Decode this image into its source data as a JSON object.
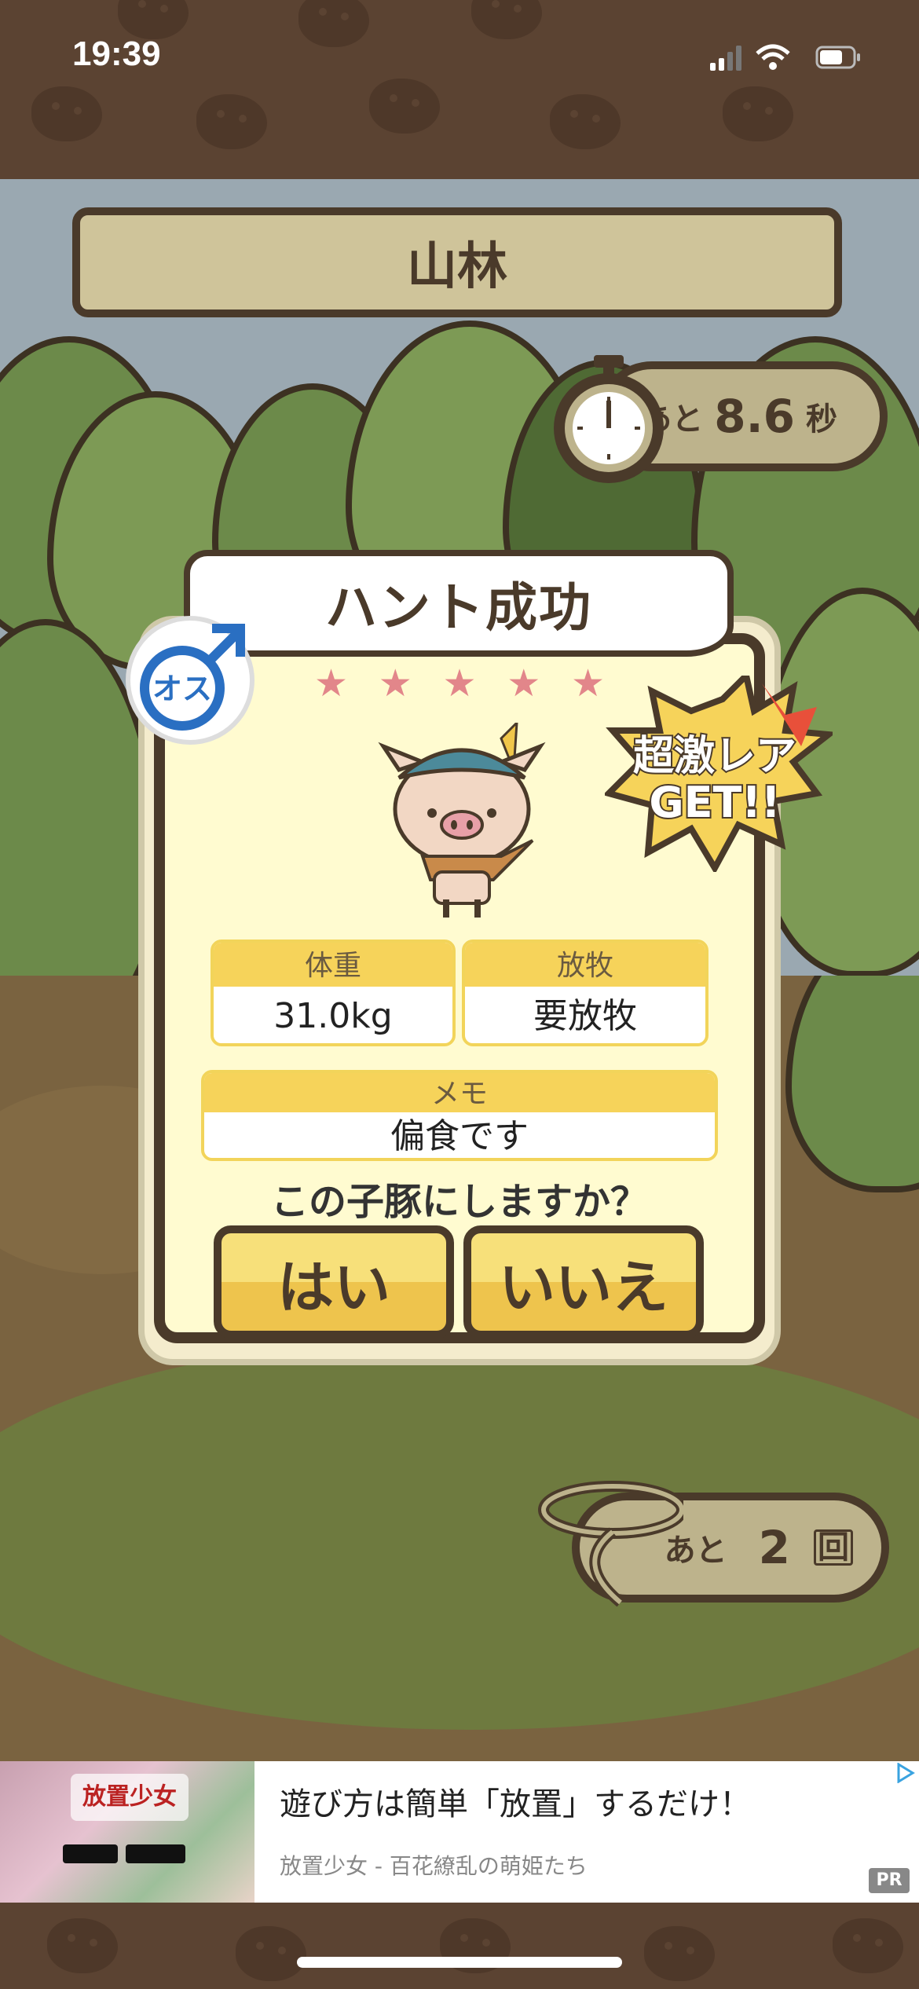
{
  "status_bar": {
    "time": "19:39"
  },
  "location": {
    "title": "山林"
  },
  "timer": {
    "prefix": "あと",
    "value": "8.6",
    "unit": "秒"
  },
  "dialog": {
    "banner": "ハント成功",
    "stars": 5,
    "gender_label": "オス",
    "rare_badge": [
      "超激レア",
      "GET!!"
    ],
    "stats": {
      "weight_label": "体重",
      "weight_value": "31.0kg",
      "grazing_label": "放牧",
      "grazing_value": "要放牧",
      "memo_label": "メモ",
      "memo_value": "偏食です"
    },
    "question": "この子豚にしますか？",
    "yes_label": "はい",
    "no_label": "いいえ"
  },
  "remaining": {
    "prefix": "あと",
    "value": "2",
    "unit": "回"
  },
  "ad": {
    "logo_text": "放置少女",
    "headline": "遊び方は簡単「放置」するだけ！",
    "subtitle": "放置少女 - 百花繚乱の萌姫たち",
    "pr": "PR"
  },
  "colors": {
    "wood_dark": "#4a3a2a",
    "gold": "#f6d35a",
    "pink_star": "#e2868a",
    "gender_blue": "#2a6fc2"
  }
}
